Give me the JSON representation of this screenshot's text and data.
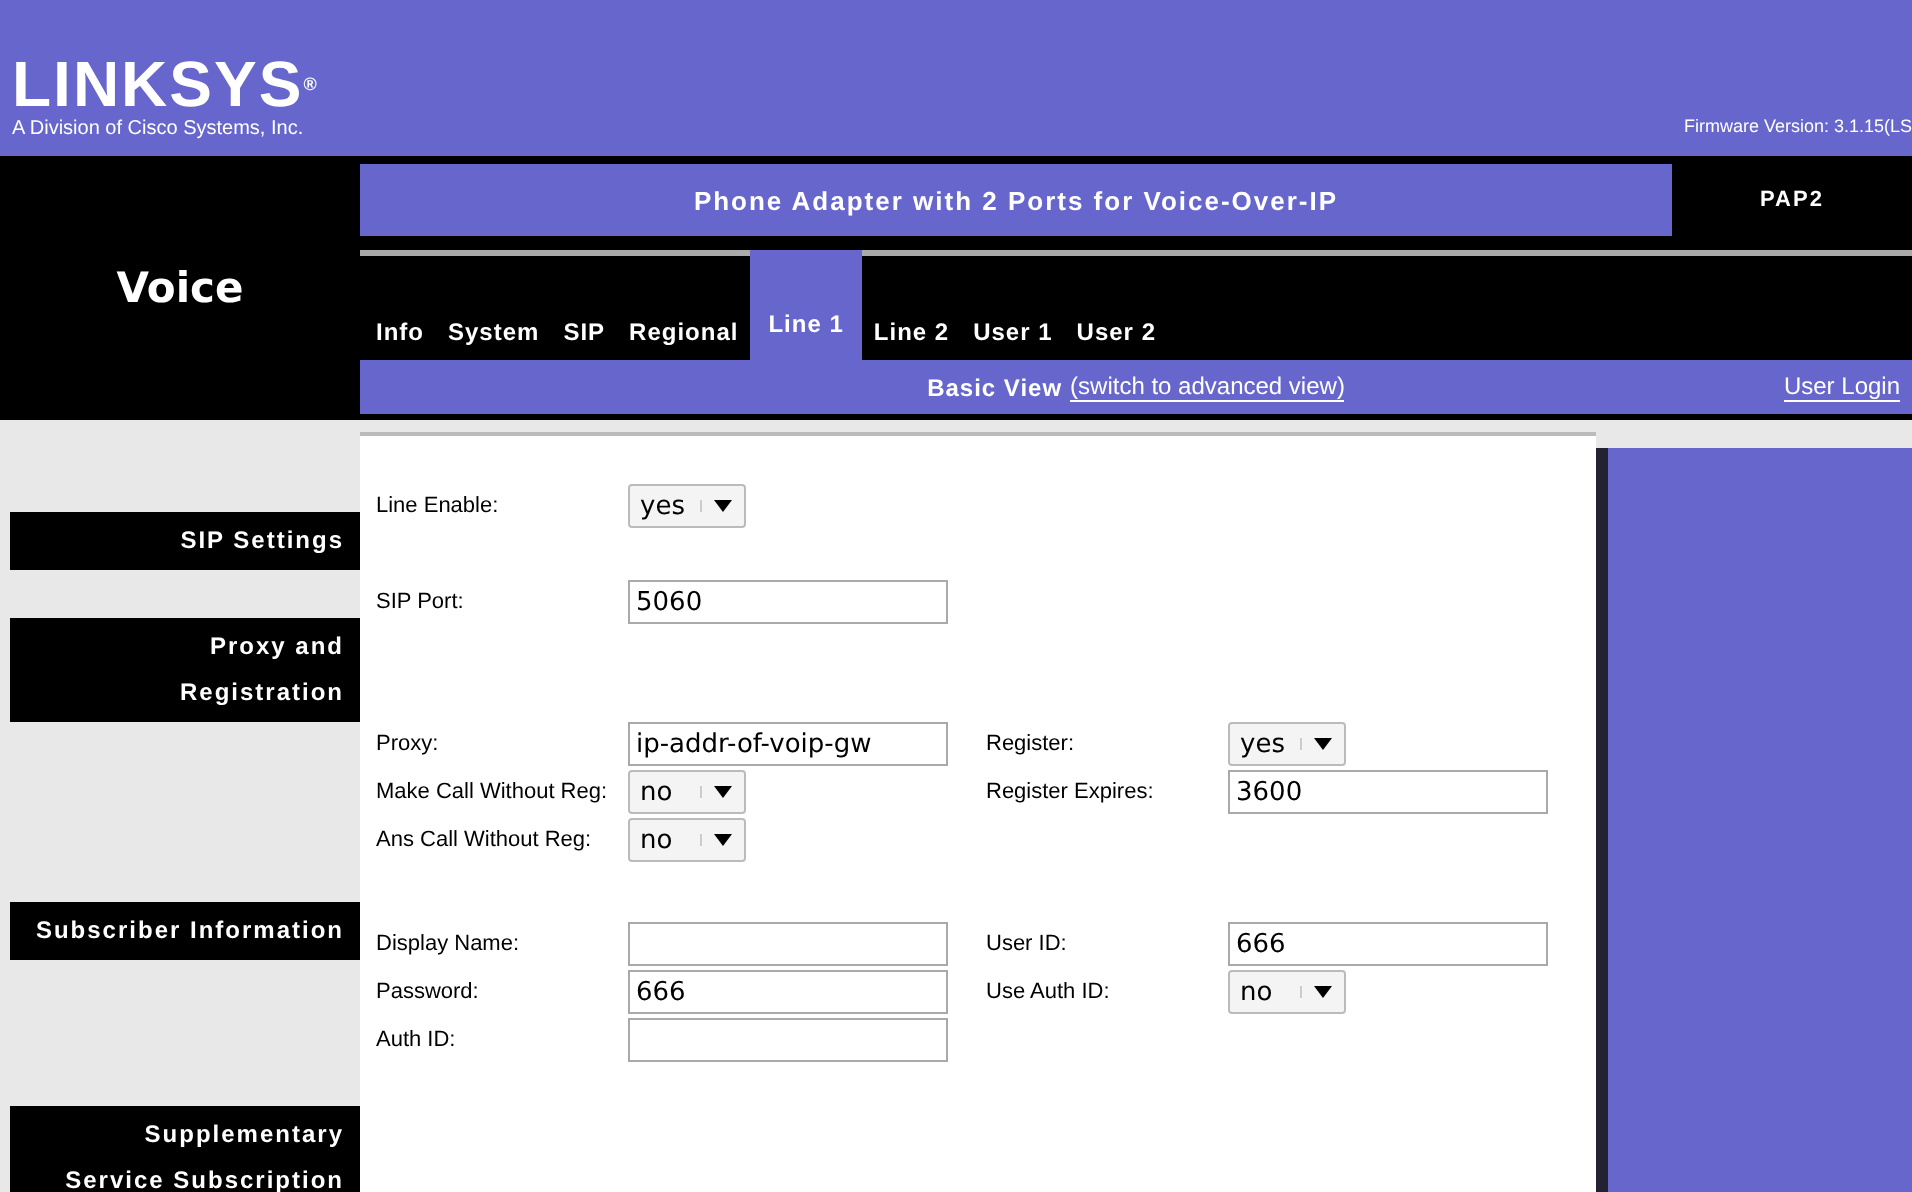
{
  "header": {
    "logo": "LINKSYS$^{®}$",
    "tagline": "A Division of Cisco Systems, Inc.",
    "firmware": "Firmware Version: 3.1.15(LS"
  },
  "section_title": "Voice",
  "product_title": "Phone Adapter with 2 Ports for Voice-Over-IP",
  "model": "PAP2",
  "tabs": [
    {
      "label": "Info",
      "selected": false
    },
    {
      "label": "System",
      "selected": false
    },
    {
      "label": "SIP",
      "selected": false
    },
    {
      "label": "Regional",
      "selected": false
    },
    {
      "label": "Line 1",
      "selected": true
    },
    {
      "label": "Line 2",
      "selected": false
    },
    {
      "label": "User 1",
      "selected": false
    },
    {
      "label": "User 2",
      "selected": false
    }
  ],
  "view_bar": {
    "label": "Basic View",
    "link": "(switch to advanced view)",
    "login": "User Login"
  },
  "sidebar_headings": [
    {
      "lines": [
        "SIP Settings"
      ]
    },
    {
      "lines": [
        "Proxy and",
        "Registration"
      ]
    },
    {
      "lines": [
        "Subscriber Information"
      ]
    },
    {
      "lines": [
        "Supplementary",
        "Service Subscription"
      ]
    }
  ],
  "groups": [
    {
      "rows": [
        {
          "left": {
            "label": "Line Enable:",
            "kind": "select",
            "value": "yes"
          }
        }
      ]
    },
    {
      "rows": [
        {
          "left": {
            "label": "SIP Port:",
            "kind": "text",
            "value": "5060"
          }
        }
      ]
    },
    {
      "rows": [
        {
          "left": {
            "label": "Proxy:",
            "kind": "text",
            "value": "ip-addr-of-voip-gw"
          },
          "right": {
            "label": "Register:",
            "kind": "select",
            "value": "yes"
          }
        },
        {
          "left": {
            "label": "Make Call Without Reg:",
            "kind": "select",
            "value": "no"
          },
          "right": {
            "label": "Register Expires:",
            "kind": "text",
            "value": "3600"
          }
        },
        {
          "left": {
            "label": "Ans Call Without Reg:",
            "kind": "select",
            "value": "no"
          }
        }
      ]
    },
    {
      "rows": [
        {
          "left": {
            "label": "Display Name:",
            "kind": "text"
          },
          "right": {
            "label": "User ID:",
            "kind": "text",
            "value": "666"
          }
        },
        {
          "left": {
            "label": "Password:",
            "kind": "text",
            "value": "666"
          },
          "right": {
            "label": "Use Auth ID:",
            "kind": "select",
            "value": "no"
          }
        },
        {
          "left": {
            "label": "Auth ID:",
            "kind": "text"
          }
        }
      ]
    }
  ]
}
